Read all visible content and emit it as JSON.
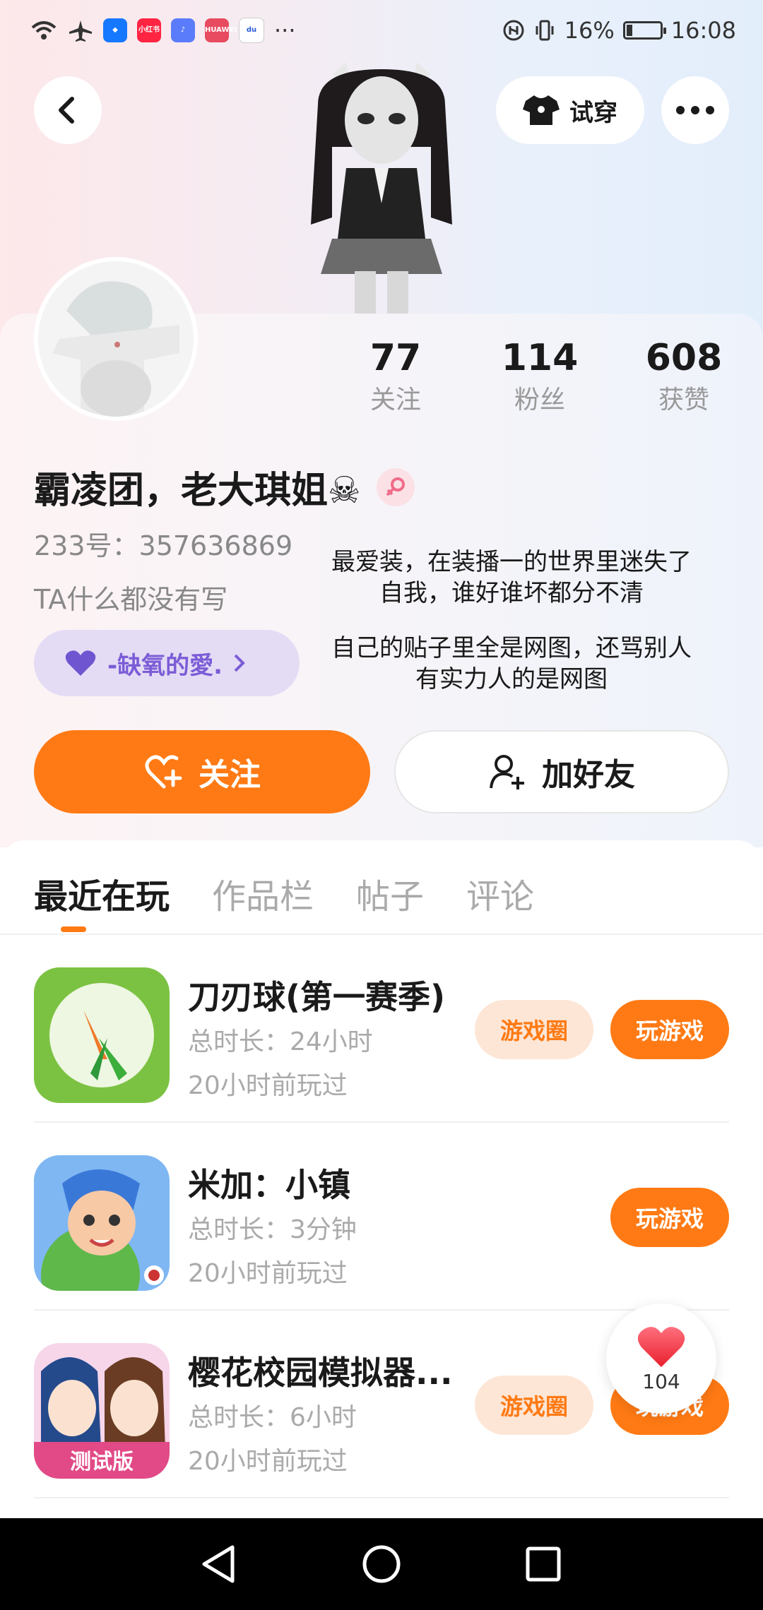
{
  "status_bar": {
    "apps": [
      "小红书",
      "HUAWEI"
    ],
    "more": "···",
    "battery": "16%",
    "battery_level": 0.16,
    "time": "16:08"
  },
  "header": {
    "tryon_label": "试穿"
  },
  "stats": [
    {
      "value": "77",
      "label": "关注"
    },
    {
      "value": "114",
      "label": "粉丝"
    },
    {
      "value": "608",
      "label": "获赞"
    }
  ],
  "profile": {
    "username": "霸凌团，老大琪姐☠",
    "uid": "233号：357636869",
    "bio": "TA什么都没有写",
    "guild": "-缺氧的愛."
  },
  "overlay": {
    "line1": "最爱装，在装播一的世界里迷失了",
    "line2": "自我，谁好谁坏都分不清",
    "line3": "自己的贴子里全是网图，还骂别人",
    "line4": "有实力人的是网图"
  },
  "actions": {
    "follow": "关注",
    "add_friend": "加好友"
  },
  "tabs": [
    "最近在玩",
    "作品栏",
    "帖子",
    "评论"
  ],
  "games": [
    {
      "name": "刀刃球(第一赛季)",
      "time": "总时长：24小时",
      "last": "20小时前玩过",
      "circle": "游戏圈",
      "play": "玩游戏"
    },
    {
      "name": "米加：小镇",
      "time": "总时长：3分钟",
      "last": "20小时前玩过",
      "play": "玩游戏"
    },
    {
      "name": "樱花校园模拟器...",
      "time": "总时长：6小时",
      "last": "20小时前玩过",
      "circle": "游戏圈",
      "play": "玩游戏",
      "icon_badge": "测试版"
    }
  ],
  "like_fab": {
    "count": "104"
  },
  "colors": {
    "accent": "#ff7a14",
    "guild": "#7b5cd6"
  }
}
